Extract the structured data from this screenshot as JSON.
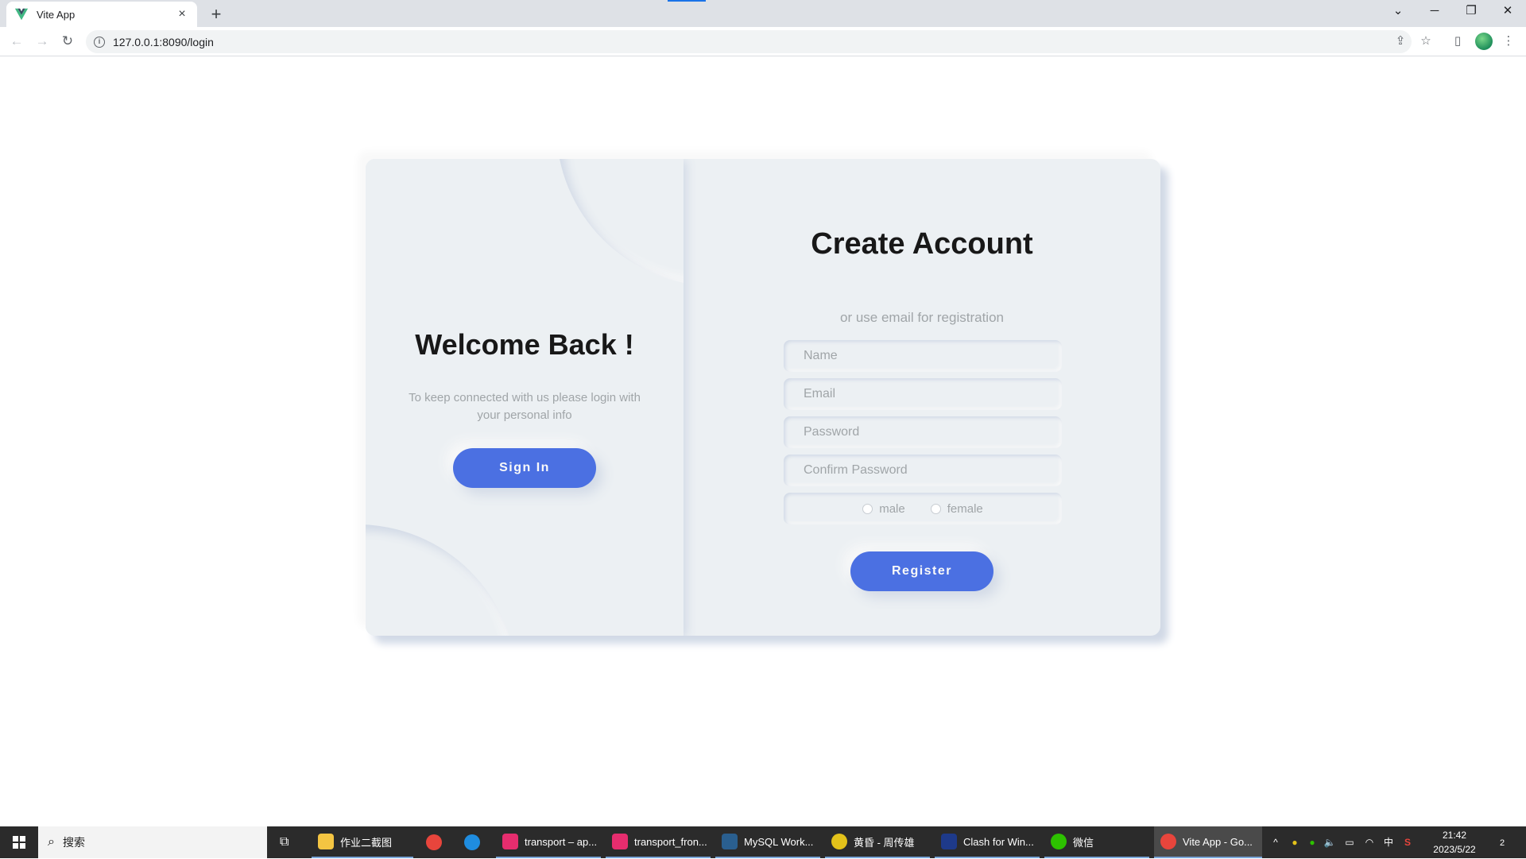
{
  "browser": {
    "tab_title": "Vite App",
    "tab_close": "×",
    "new_tab": "+",
    "url": "127.0.0.1:8090/login",
    "win_controls": {
      "tabsearch": "⌄",
      "minimize": "─",
      "restore": "❐",
      "close": "✕"
    },
    "nav": {
      "back": "←",
      "forward": "→",
      "reload": "↻"
    },
    "toolbar_icons": {
      "share": "⇪",
      "bookmark": "☆",
      "sidepanel": "▯",
      "menu": "⋮"
    }
  },
  "left_panel": {
    "title": "Welcome Back !",
    "text": "To keep connected with us please login with your personal info",
    "button": "Sign In"
  },
  "right_panel": {
    "title": "Create Account",
    "subtitle": "or use email for registration",
    "fields": {
      "name": "Name",
      "email": "Email",
      "password": "Password",
      "confirm": "Confirm Password"
    },
    "gender": {
      "male": "male",
      "female": "female"
    },
    "button": "Register"
  },
  "taskbar": {
    "search": "搜索",
    "apps": [
      {
        "label": "作业二截图",
        "color": "#f4c542"
      },
      {
        "label": "",
        "color": "#e8453c"
      },
      {
        "label": "",
        "color": "#1f8de0"
      },
      {
        "label": "transport – ap...",
        "color": "#e62d6e"
      },
      {
        "label": "transport_fron...",
        "color": "#e62d6e"
      },
      {
        "label": "MySQL Work...",
        "color": "#2a5f8f"
      },
      {
        "label": "黄昏 - 周传雄",
        "color": "#e3c21a"
      },
      {
        "label": "Clash for Win...",
        "color": "#1e3a8a"
      },
      {
        "label": "微信",
        "color": "#2dc100"
      },
      {
        "label": "Vite App - Go...",
        "color": "#e8453c"
      }
    ],
    "tray_chevron": "^",
    "ime": "中",
    "time": "21:42",
    "date": "2023/5/22",
    "notifications": "2"
  },
  "colors": {
    "accent": "#4b70e2",
    "card_bg": "#ecf0f3",
    "muted_text": "#a0a5a8"
  }
}
